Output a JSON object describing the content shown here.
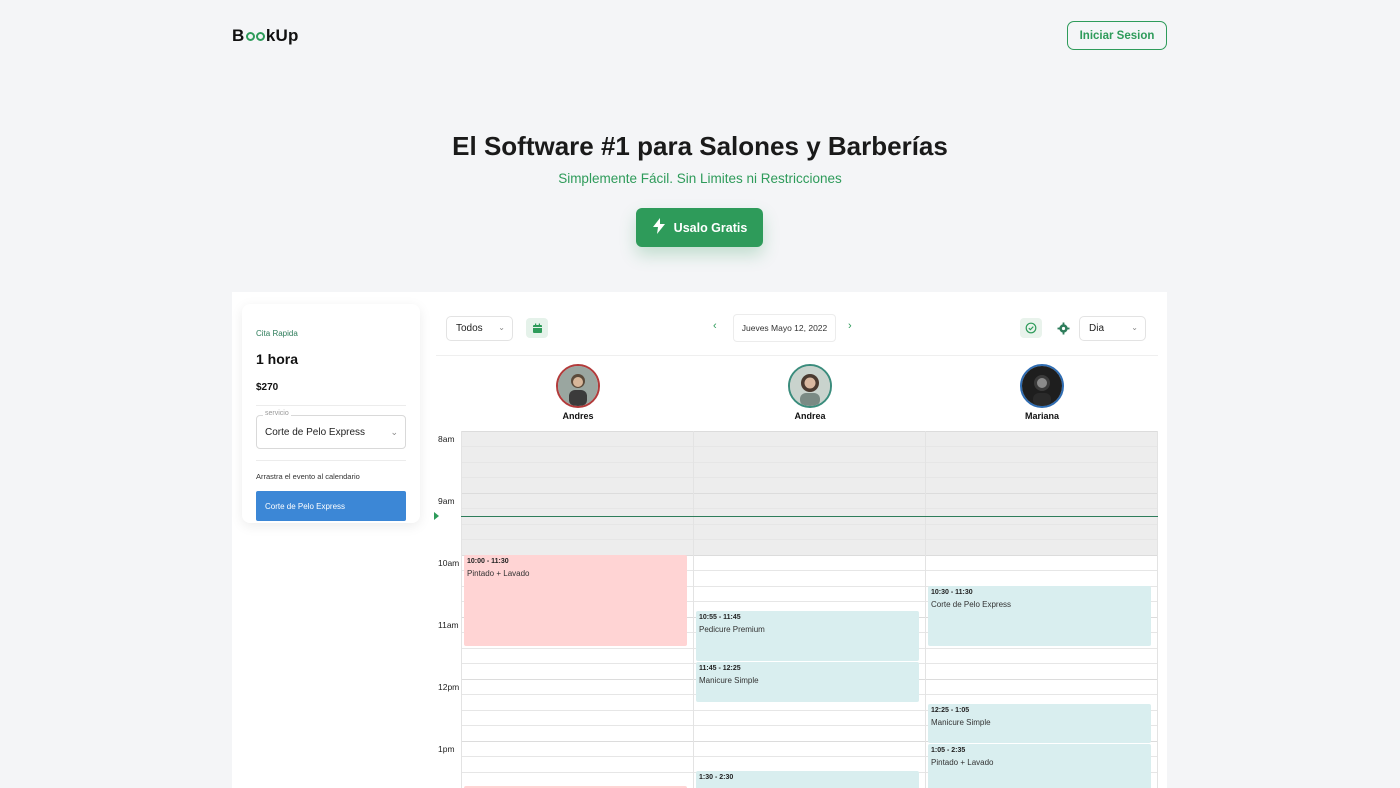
{
  "header": {
    "logo_text": "BookUp",
    "logo_parts": {
      "prefix": "B",
      "suffix": "kUp"
    },
    "login_label": "Iniciar Sesion"
  },
  "hero": {
    "title": "El Software #1 para Salones y Barberías",
    "subtitle": "Simplemente Fácil. Sin Limites ni Restricciones",
    "cta_label": "Usalo Gratis",
    "cta_icon": "lightning-icon"
  },
  "quick_appointment": {
    "label": "Cita Rapida",
    "duration": "1 hora",
    "price": "$270",
    "service_field_label": "servicio",
    "service_value": "Corte de Pelo Express",
    "drag_hint": "Arrastra el evento al calendario",
    "draggable_event": "Corte de Pelo Express"
  },
  "toolbar": {
    "filter_value": "Todos",
    "date": "Jueves Mayo 12, 2022",
    "view_value": "Dia",
    "prev_icon": "chevron-left-icon",
    "next_icon": "chevron-right-icon"
  },
  "staff": [
    {
      "name": "Andres",
      "ring_color": "#b23a3a"
    },
    {
      "name": "Andrea",
      "ring_color": "#3a8c7c"
    },
    {
      "name": "Mariana",
      "ring_color": "#2f6db3"
    }
  ],
  "time_labels": [
    "8am",
    "9am",
    "10am",
    "11am",
    "12pm",
    "1pm"
  ],
  "events": [
    {
      "staff": "Andres",
      "time": "10:00 - 11:30",
      "service": "Pintado + Lavado",
      "color": "#ffd4d4"
    },
    {
      "staff": "Andrea",
      "time": "10:55 - 11:45",
      "service": "Pedicure Premium",
      "color": "#d9eeef"
    },
    {
      "staff": "Andrea",
      "time": "11:45 - 12:25",
      "service": "Manicure Simple",
      "color": "#d9eeef"
    },
    {
      "staff": "Andrea",
      "time": "1:30 - 2:30",
      "service": "",
      "color": "#d9eeef"
    },
    {
      "staff": "Mariana",
      "time": "10:30 - 11:30",
      "service": "Corte de Pelo Express",
      "color": "#d9eeef"
    },
    {
      "staff": "Mariana",
      "time": "12:25 - 1:05",
      "service": "Manicure Simple",
      "color": "#d9eeef"
    },
    {
      "staff": "Mariana",
      "time": "1:05 - 2:35",
      "service": "Pintado + Lavado",
      "color": "#d9eeef"
    }
  ],
  "colors": {
    "brand_green": "#2e9b5a",
    "event_blue": "#3c87d6"
  }
}
